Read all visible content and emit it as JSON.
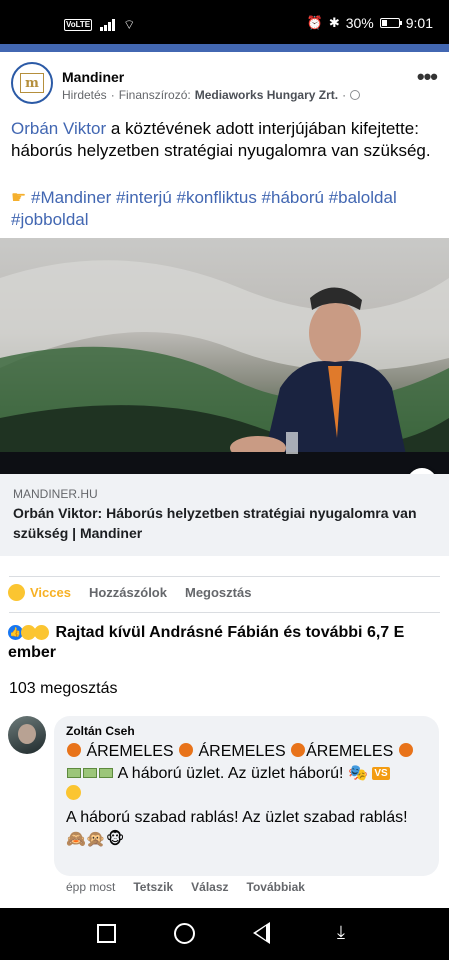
{
  "status_bar": {
    "volte": "VoLTE",
    "battery": "30%",
    "time": "9:01"
  },
  "post": {
    "page_name": "Mandiner",
    "logo_letter": "m",
    "sponsored_label": "Hirdetés",
    "funded_by_label": "Finanszírozó:",
    "funded_by": "Mediaworks Hungary Zrt.",
    "text_link": "Orbán Viktor",
    "text_rest": " a köztévének adott interjújában kifejtette: háborús helyzetben stratégiai nyugalomra van szükség.",
    "hashtags": "#Mandiner #interjú #konfliktus #háború #baloldal #jobboldal",
    "info_symbol": "i",
    "link_domain": "MANDINER.HU",
    "link_title": "Orbán Viktor: Háborús helyzetben stratégiai nyugalomra van szükség | Mandiner"
  },
  "actions": {
    "react_label": "Vicces",
    "comment_label": "Hozzászólok",
    "share_label": "Megosztás"
  },
  "reactions_summary": "Rajtad kívül Andrásné Fábián és további 6,7 E ember",
  "shares_count": "103 megosztás",
  "comment": {
    "author": "Zoltán Cseh",
    "line1_words": [
      "ÁREMELES",
      "ÁREMELES",
      "ÁREMELES"
    ],
    "line2": "A háború üzlet. Az üzlet háború!",
    "vs_badge": "VS",
    "line3": "A háború szabad rablás! Az üzlet szabad rablás!",
    "time": "épp most",
    "like_label": "Tetszik",
    "reply_label": "Válasz",
    "more_label": "Továbbiak"
  }
}
